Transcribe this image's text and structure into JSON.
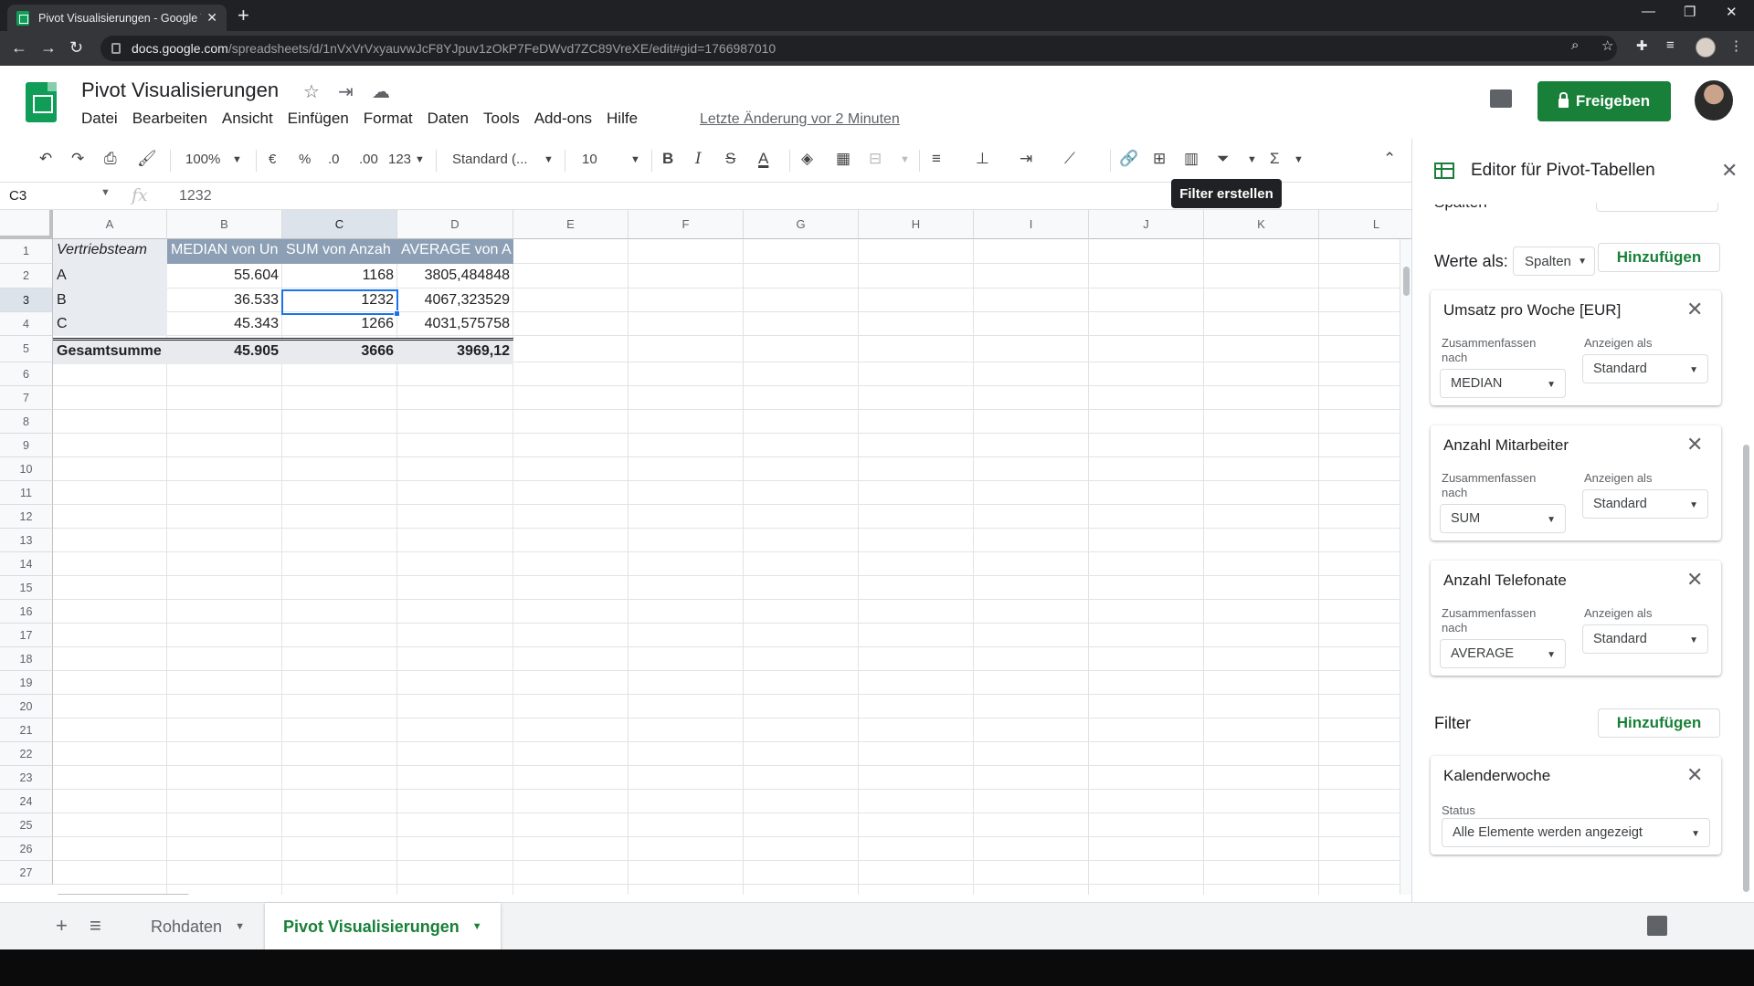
{
  "browser": {
    "tab_title": "Pivot Visualisierungen - Google T",
    "url_host": "docs.google.com",
    "url_path": "/spreadsheets/d/1nVxVrVxyauvwJcF8YJpuv1zOkP7FeDWvd7ZC89VreXE/edit#gid=1766987010"
  },
  "doc": {
    "title": "Pivot Visualisierungen",
    "menu": [
      "Datei",
      "Bearbeiten",
      "Ansicht",
      "Einfügen",
      "Format",
      "Daten",
      "Tools",
      "Add-ons",
      "Hilfe"
    ],
    "last_edit": "Letzte Änderung vor 2 Minuten",
    "share_label": "Freigeben"
  },
  "toolbar": {
    "zoom": "100%",
    "currency": "€",
    "percent": "%",
    "dec_less": ".0",
    "dec_more": ".00",
    "more_formats": "123",
    "font": "Standard (...",
    "font_size": "10",
    "tooltip": "Filter erstellen"
  },
  "formula_bar": {
    "cell_ref": "C3",
    "fx": "fx",
    "value": "1232"
  },
  "grid": {
    "columns": [
      "A",
      "B",
      "C",
      "D",
      "E",
      "F",
      "G",
      "H",
      "I",
      "J",
      "K",
      "L"
    ],
    "rows": [
      "1",
      "2",
      "3",
      "4",
      "5",
      "6",
      "7",
      "8",
      "9",
      "10",
      "11",
      "12",
      "13",
      "14",
      "15",
      "16",
      "17",
      "18",
      "19",
      "20",
      "21",
      "22",
      "23",
      "24",
      "25",
      "26",
      "27"
    ],
    "pivot": {
      "header": [
        "Vertriebsteam",
        "MEDIAN von Un",
        "SUM von Anzah",
        "AVERAGE von A"
      ],
      "rows": [
        [
          "A",
          "55.604",
          "1168",
          "3805,484848"
        ],
        [
          "B",
          "36.533",
          "1232",
          "4067,323529"
        ],
        [
          "C",
          "45.343",
          "1266",
          "4031,575758"
        ]
      ],
      "total": [
        "Gesamtsumme",
        "45.905",
        "3666",
        "3969,12"
      ]
    }
  },
  "sheet_tabs": {
    "tabs": [
      "Rohdaten",
      "Pivot Visualisierungen"
    ],
    "active": "Pivot Visualisierungen"
  },
  "pivot_editor": {
    "title": "Editor für Pivot-Tabellen",
    "cut_top_label": "Spalten",
    "werte_label": "Werte als:",
    "werte_value": "Spalten",
    "add_label": "Hinzufügen",
    "summarize_label": "Zusammenfassen nach",
    "show_as_label": "Anzeigen als",
    "values": [
      {
        "name": "Umsatz pro Woche [EUR]",
        "summarize": "MEDIAN",
        "show_as": "Standard"
      },
      {
        "name": "Anzahl Mitarbeiter",
        "summarize": "SUM",
        "show_as": "Standard"
      },
      {
        "name": "Anzahl Telefonate",
        "summarize": "AVERAGE",
        "show_as": "Standard"
      }
    ],
    "filter_label": "Filter",
    "filters": [
      {
        "name": "Kalenderwoche",
        "status_label": "Status",
        "status": "Alle Elemente werden angezeigt"
      }
    ]
  }
}
